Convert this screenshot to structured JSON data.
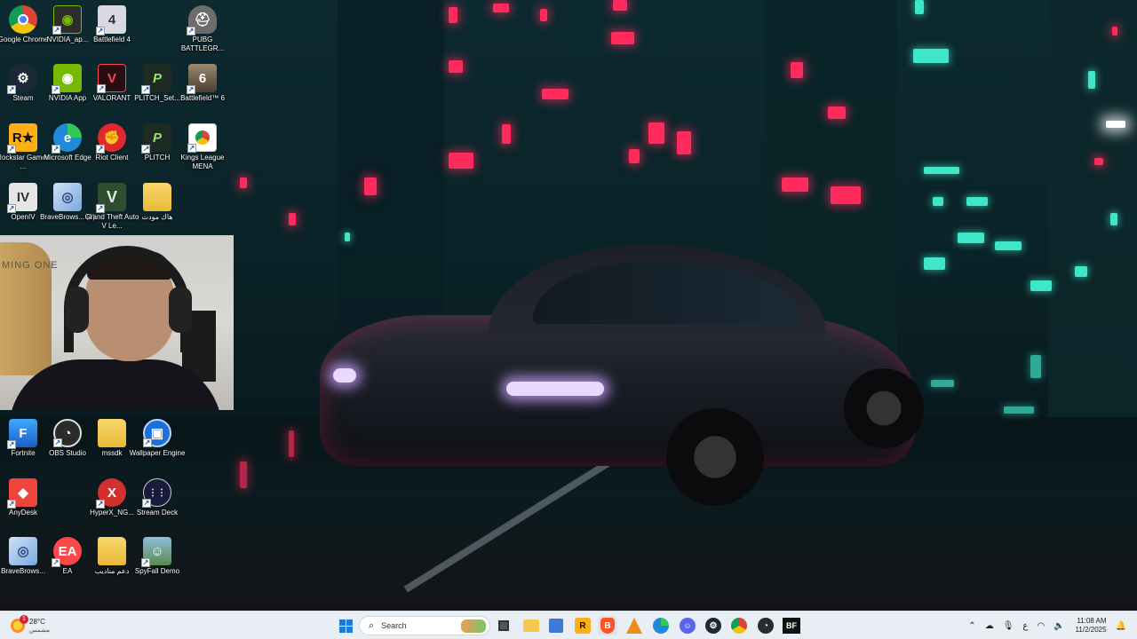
{
  "desktop": {
    "icons": [
      {
        "label": "Google Chrome",
        "icon": "chrome-icon",
        "color": "#ffffff"
      },
      {
        "label": "NVIDIA_ap...",
        "icon": "nvidia-icon",
        "color": "#76b900"
      },
      {
        "label": "Battlefield 4",
        "icon": "battlefield4-icon",
        "color": "#3a3a4a"
      },
      {
        "label": "PUBG BATTLEGR...",
        "icon": "pubg-icon",
        "color": "#5a5a5a"
      },
      {
        "label": "Steam",
        "icon": "steam-icon",
        "color": "#1b2838"
      },
      {
        "label": "NVIDIA App",
        "icon": "nvidia-app-icon",
        "color": "#76b900"
      },
      {
        "label": "VALORANT",
        "icon": "valorant-icon",
        "color": "#ff4655"
      },
      {
        "label": "PLITCH_Set...",
        "icon": "plitch-setup-icon",
        "color": "#1d2b22"
      },
      {
        "label": "Battlefield™ 6",
        "icon": "battlefield6-icon",
        "color": "#7a6a52"
      },
      {
        "label": "Rockstar Games ...",
        "icon": "rockstar-icon",
        "color": "#fcaf17"
      },
      {
        "label": "Microsoft Edge",
        "icon": "edge-icon",
        "color": "#1f8ad6"
      },
      {
        "label": "Riot Client",
        "icon": "riot-icon",
        "color": "#e0282e"
      },
      {
        "label": "PLITCH",
        "icon": "plitch-icon",
        "color": "#1d2b22"
      },
      {
        "label": "Kings League MENA",
        "icon": "kings-league-chrome-icon",
        "color": "#ffffff"
      },
      {
        "label": "OpenIV",
        "icon": "openiv-icon",
        "color": "#555555"
      },
      {
        "label": "BraveBrows... (1)",
        "icon": "installer-disc-icon",
        "color": "#7aa7e0"
      },
      {
        "label": "Grand Theft Auto V Le...",
        "icon": "gta-v-icon",
        "color": "#3d6b3d"
      },
      {
        "label": "هاك مودت",
        "icon": "folder-icon",
        "color": "#f3c94f"
      },
      {
        "label": "Fortnite",
        "icon": "fortnite-icon",
        "color": "#2a8de0"
      },
      {
        "label": "OBS Studio",
        "icon": "obs-icon",
        "color": "#2b2b2b"
      },
      {
        "label": "mssdk",
        "icon": "folder-icon",
        "color": "#f3c94f"
      },
      {
        "label": "Wallpaper Engine",
        "icon": "wallpaper-engine-icon",
        "color": "#1e6fd9"
      },
      {
        "label": "AnyDesk",
        "icon": "anydesk-icon",
        "color": "#ef443b"
      },
      {
        "label": "HyperX_NG...",
        "icon": "hyperx-icon",
        "color": "#d32f2f"
      },
      {
        "label": "Stream Deck",
        "icon": "stream-deck-icon",
        "color": "#1a1a3a"
      },
      {
        "label": "BraveBrows...",
        "icon": "installer-disc-icon",
        "color": "#7aa7e0"
      },
      {
        "label": "EA",
        "icon": "ea-icon",
        "color": "#ff4747"
      },
      {
        "label": "دعم مناديب",
        "icon": "folder-icon",
        "color": "#f3c94f"
      },
      {
        "label": "SpyFall Demo",
        "icon": "spyfall-icon",
        "color": "#5b8a4a"
      }
    ]
  },
  "webcam": {
    "door_text": "MING ONE"
  },
  "taskbar": {
    "weather": {
      "temp": "28°C",
      "condition": "مشمس",
      "badge": "1"
    },
    "search": {
      "placeholder": "Search"
    },
    "pinned": [
      {
        "name": "file-explorer-icon",
        "color": "#f3c94f"
      },
      {
        "name": "microsoft-store-icon",
        "color": "#3b7bd6"
      },
      {
        "name": "rockstar-taskbar-icon",
        "color": "#fcaf17"
      },
      {
        "name": "brave-icon",
        "color": "#fb542b"
      },
      {
        "name": "vlc-icon",
        "color": "#f08c1a"
      },
      {
        "name": "edge-taskbar-icon",
        "color": "#1f8ad6"
      },
      {
        "name": "discord-icon",
        "color": "#5865f2"
      },
      {
        "name": "steam-taskbar-icon",
        "color": "#1b2838"
      },
      {
        "name": "chrome-taskbar-icon",
        "color": "#4caf50"
      },
      {
        "name": "obs-taskbar-icon",
        "color": "#2b2b2b"
      },
      {
        "name": "bf-taskbar-icon",
        "color": "#111111"
      }
    ],
    "bf_label": "BF",
    "tray": {
      "language": "ع",
      "time": "11:08 AM",
      "date": "11/2/2025"
    }
  }
}
